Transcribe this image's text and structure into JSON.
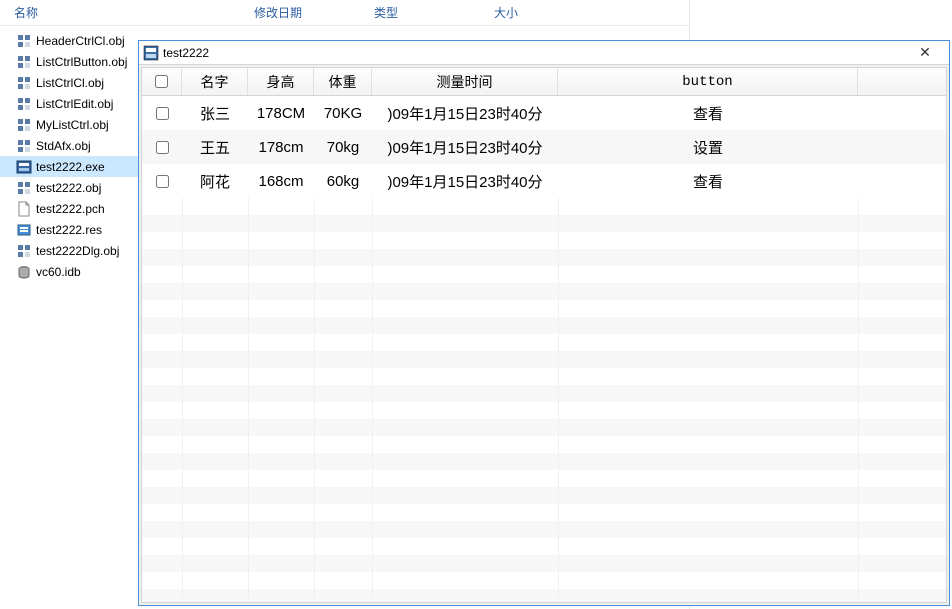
{
  "explorer": {
    "header": {
      "name": "名称",
      "date": "修改日期",
      "type": "类型",
      "size": "大小"
    },
    "files": [
      {
        "label": "HeaderCtrlCl.obj",
        "icon": "obj",
        "selected": false
      },
      {
        "label": "ListCtrlButton.obj",
        "icon": "obj",
        "selected": false
      },
      {
        "label": "ListCtrlCl.obj",
        "icon": "obj",
        "selected": false
      },
      {
        "label": "ListCtrlEdit.obj",
        "icon": "obj",
        "selected": false
      },
      {
        "label": "MyListCtrl.obj",
        "icon": "obj",
        "selected": false
      },
      {
        "label": "StdAfx.obj",
        "icon": "obj",
        "selected": false
      },
      {
        "label": "test2222.exe",
        "icon": "exe",
        "selected": true
      },
      {
        "label": "test2222.obj",
        "icon": "obj",
        "selected": false
      },
      {
        "label": "test2222.pch",
        "icon": "pch",
        "selected": false
      },
      {
        "label": "test2222.res",
        "icon": "res",
        "selected": false
      },
      {
        "label": "test2222Dlg.obj",
        "icon": "obj",
        "selected": false
      },
      {
        "label": "vc60.idb",
        "icon": "idb",
        "selected": false
      }
    ]
  },
  "dialog": {
    "title": "test2222",
    "columns": {
      "chk": "",
      "name": "名字",
      "height": "身高",
      "weight": "体重",
      "time": "测量时间",
      "button": "button"
    },
    "rows": [
      {
        "name": "张三",
        "height": "178CM",
        "weight": "70KG",
        "time": ")09年1月15日23时40分",
        "button": "查看"
      },
      {
        "name": "王五",
        "height": "178cm",
        "weight": "70kg",
        "time": ")09年1月15日23时40分",
        "button": "设置"
      },
      {
        "name": "阿花",
        "height": "168cm",
        "weight": "60kg",
        "time": ")09年1月15日23时40分",
        "button": "查看"
      }
    ]
  }
}
